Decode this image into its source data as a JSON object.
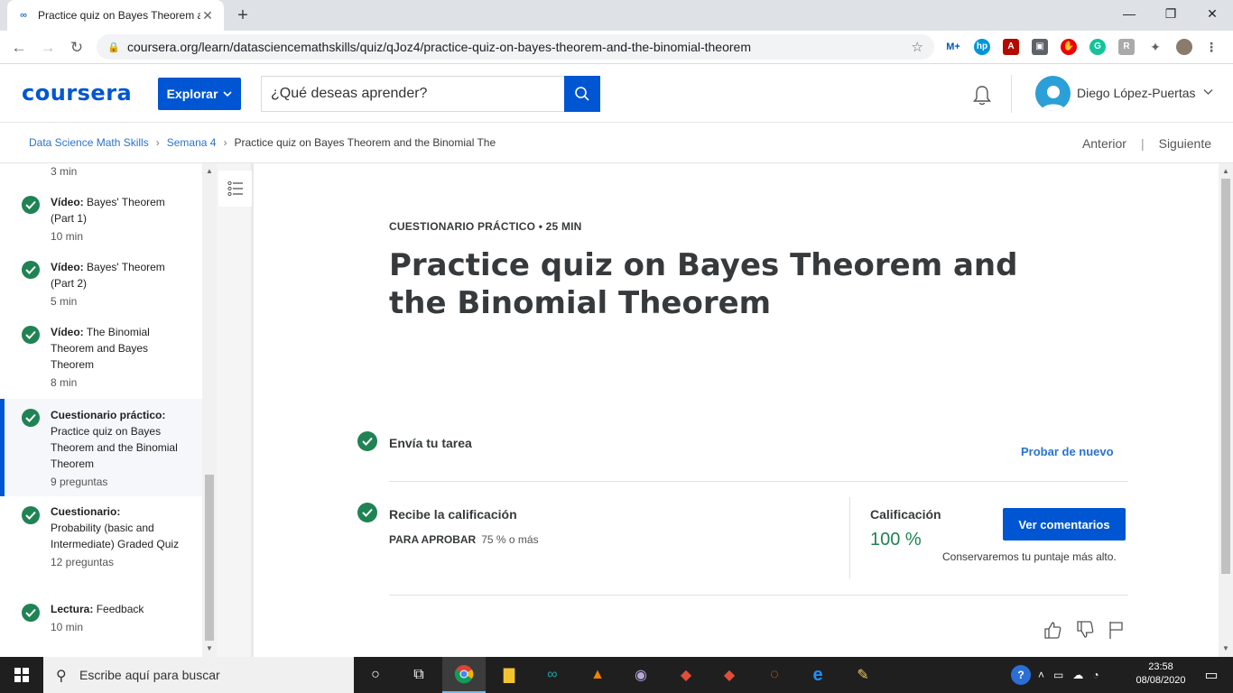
{
  "browser": {
    "tab_title": "Practice quiz on Bayes Theorem a",
    "url": "coursera.org/learn/datasciencemathskills/quiz/qJoz4/practice-quiz-on-bayes-theorem-and-the-binomial-theorem"
  },
  "header": {
    "logo": "coursera",
    "explore_label": "Explorar",
    "search_placeholder": "¿Qué deseas aprender?",
    "user_name": "Diego López-Puertas"
  },
  "breadcrumb": {
    "items": [
      "Data Science Math Skills",
      "Semana 4"
    ],
    "current": "Practice quiz on Bayes Theorem and the Binomial The",
    "prev": "Anterior",
    "next": "Siguiente"
  },
  "sidebar": {
    "top_meta": "3 min",
    "items": [
      {
        "type": "Vídeo:",
        "title": "Bayes' Theorem (Part 1)",
        "meta": "10 min"
      },
      {
        "type": "Vídeo:",
        "title": "Bayes' Theorem (Part 2)",
        "meta": "5 min"
      },
      {
        "type": "Vídeo:",
        "title": "The Binomial Theorem and Bayes Theorem",
        "meta": "8 min"
      },
      {
        "type": "Cuestionario práctico:",
        "title": "Practice quiz on Bayes Theorem and the Binomial Theorem",
        "meta": "9 preguntas"
      },
      {
        "type": "Cuestionario:",
        "title": "Probability (basic and Intermediate) Graded Quiz",
        "meta": "12 preguntas"
      },
      {
        "type": "Lectura:",
        "title": "Feedback",
        "meta": "10 min"
      }
    ]
  },
  "main": {
    "kicker": "CUESTIONARIO PRÁCTICO • 25 MIN",
    "title": "Practice quiz on Bayes Theorem and the Binomial Theorem",
    "step1_label": "Envía tu tarea",
    "retry_label": "Probar de nuevo",
    "step2_label": "Recibe la calificación",
    "pass_label": "PARA APROBAR",
    "pass_value": "75 % o más",
    "grade_label": "Calificación",
    "grade_value": "100 %",
    "feedback_button": "Ver comentarios",
    "keep_note": "Conservaremos tu puntaje más alto."
  },
  "taskbar": {
    "search_placeholder": "Escribe aquí para buscar",
    "time": "23:58",
    "date": "08/08/2020"
  },
  "colors": {
    "brand": "#0056d2",
    "success": "#1f8354",
    "link": "#2a73cc"
  }
}
